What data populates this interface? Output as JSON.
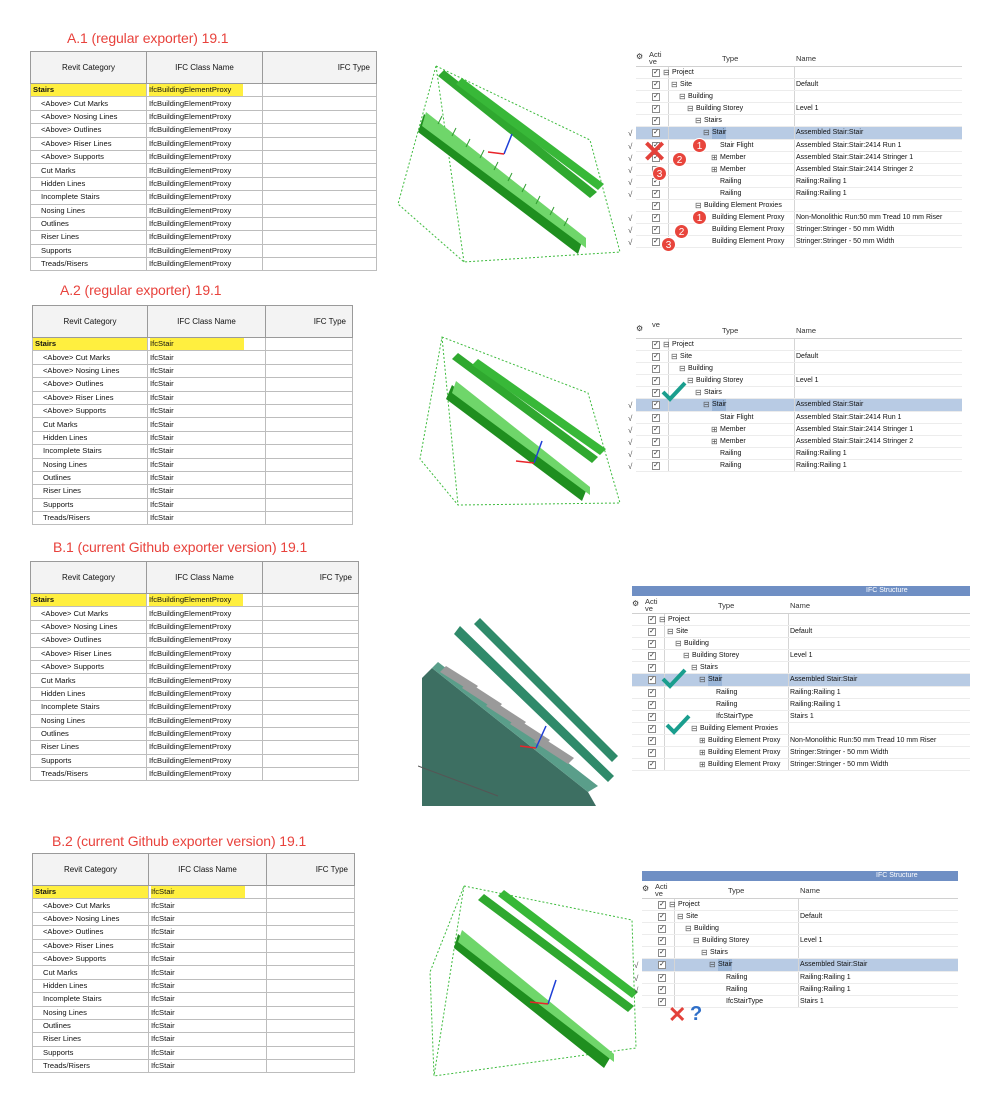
{
  "sections": {
    "a1": {
      "title": "A.1 (regular exporter) 19.1"
    },
    "a2": {
      "title": "A.2 (regular exporter) 19.1"
    },
    "b1": {
      "title": "B.1 (current Github exporter version) 19.1"
    },
    "b2": {
      "title": "B.2 (current Github exporter version) 19.1"
    }
  },
  "mapping_headers": {
    "category": "Revit Category",
    "ifc_class": "IFC Class Name",
    "ifc_type": "IFC Type"
  },
  "categories": [
    "Stairs",
    "<Above> Cut Marks",
    "<Above> Nosing Lines",
    "<Above> Outlines",
    "<Above> Riser Lines",
    "<Above> Supports",
    "Cut Marks",
    "Hidden Lines",
    "Incomplete Stairs",
    "Nosing Lines",
    "Outlines",
    "Riser Lines",
    "Supports",
    "Treads/Risers"
  ],
  "ifc_classes": {
    "proxy": "IfcBuildingElementProxy",
    "stair": "IfcStair"
  },
  "tree_headers": {
    "active": "Acti ve",
    "active_cut": "ve",
    "type": "Type",
    "name": "Name",
    "window_title": "IFC Structure"
  },
  "tree_a1": [
    {
      "type": "Project",
      "name": ""
    },
    {
      "type": "Site",
      "name": "Default"
    },
    {
      "type": "Building",
      "name": ""
    },
    {
      "type": "Building Storey",
      "name": "Level 1"
    },
    {
      "type": "Stairs",
      "name": ""
    },
    {
      "type": "Stair",
      "name": "Assembled Stair:Stair"
    },
    {
      "type": "Stair Flight",
      "name": "Assembled Stair:Stair:2414 Run 1"
    },
    {
      "type": "Member",
      "name": "Assembled Stair:Stair:2414 Stringer 1"
    },
    {
      "type": "Member",
      "name": "Assembled Stair:Stair:2414 Stringer 2"
    },
    {
      "type": "Railing",
      "name": "Railing:Railing 1"
    },
    {
      "type": "Railing",
      "name": "Railing:Railing 1"
    },
    {
      "type": "Building Element Proxies",
      "name": ""
    },
    {
      "type": "Building Element Proxy",
      "name": "Non-Monolithic Run:50 mm Tread 10 mm Riser"
    },
    {
      "type": "Building Element Proxy",
      "name": "Stringer:Stringer - 50 mm Width"
    },
    {
      "type": "Building Element Proxy",
      "name": "Stringer:Stringer - 50 mm Width"
    }
  ],
  "tree_a2": [
    {
      "type": "Project",
      "name": ""
    },
    {
      "type": "Site",
      "name": "Default"
    },
    {
      "type": "Building",
      "name": ""
    },
    {
      "type": "Building Storey",
      "name": "Level 1"
    },
    {
      "type": "Stairs",
      "name": ""
    },
    {
      "type": "Stair",
      "name": "Assembled Stair:Stair"
    },
    {
      "type": "Stair Flight",
      "name": "Assembled Stair:Stair:2414 Run 1"
    },
    {
      "type": "Member",
      "name": "Assembled Stair:Stair:2414 Stringer 1"
    },
    {
      "type": "Member",
      "name": "Assembled Stair:Stair:2414 Stringer 2"
    },
    {
      "type": "Railing",
      "name": "Railing:Railing 1"
    },
    {
      "type": "Railing",
      "name": "Railing:Railing 1"
    }
  ],
  "tree_b1": [
    {
      "type": "Project",
      "name": ""
    },
    {
      "type": "Site",
      "name": "Default"
    },
    {
      "type": "Building",
      "name": ""
    },
    {
      "type": "Building Storey",
      "name": "Level 1"
    },
    {
      "type": "Stairs",
      "name": ""
    },
    {
      "type": "Stair",
      "name": "Assembled Stair:Stair"
    },
    {
      "type": "Railing",
      "name": "Railing:Railing 1"
    },
    {
      "type": "Railing",
      "name": "Railing:Railing 1"
    },
    {
      "type": "IfcStairType",
      "name": "Stairs 1"
    },
    {
      "type": "Building Element Proxies",
      "name": ""
    },
    {
      "type": "Building Element Proxy",
      "name": "Non-Monolithic Run:50 mm Tread 10 mm Riser"
    },
    {
      "type": "Building Element Proxy",
      "name": "Stringer:Stringer - 50 mm Width"
    },
    {
      "type": "Building Element Proxy",
      "name": "Stringer:Stringer - 50 mm Width"
    }
  ],
  "tree_b2": [
    {
      "type": "Project",
      "name": ""
    },
    {
      "type": "Site",
      "name": "Default"
    },
    {
      "type": "Building",
      "name": ""
    },
    {
      "type": "Building Storey",
      "name": "Level 1"
    },
    {
      "type": "Stairs",
      "name": ""
    },
    {
      "type": "Stair",
      "name": "Assembled Stair:Stair"
    },
    {
      "type": "Railing",
      "name": "Railing:Railing 1"
    },
    {
      "type": "Railing",
      "name": "Railing:Railing 1"
    },
    {
      "type": "IfcStairType",
      "name": "Stairs 1"
    }
  ],
  "badges": [
    "1",
    "2",
    "3"
  ],
  "marks": {
    "question": "?"
  },
  "colors": {
    "highlight": "#ffef3f",
    "selection": "#b8cbe4",
    "accent_red": "#e8423c",
    "check_teal": "#1a9e8e",
    "stair_green": "#4fc04a",
    "titlebar_blue": "#6f8fc4"
  }
}
